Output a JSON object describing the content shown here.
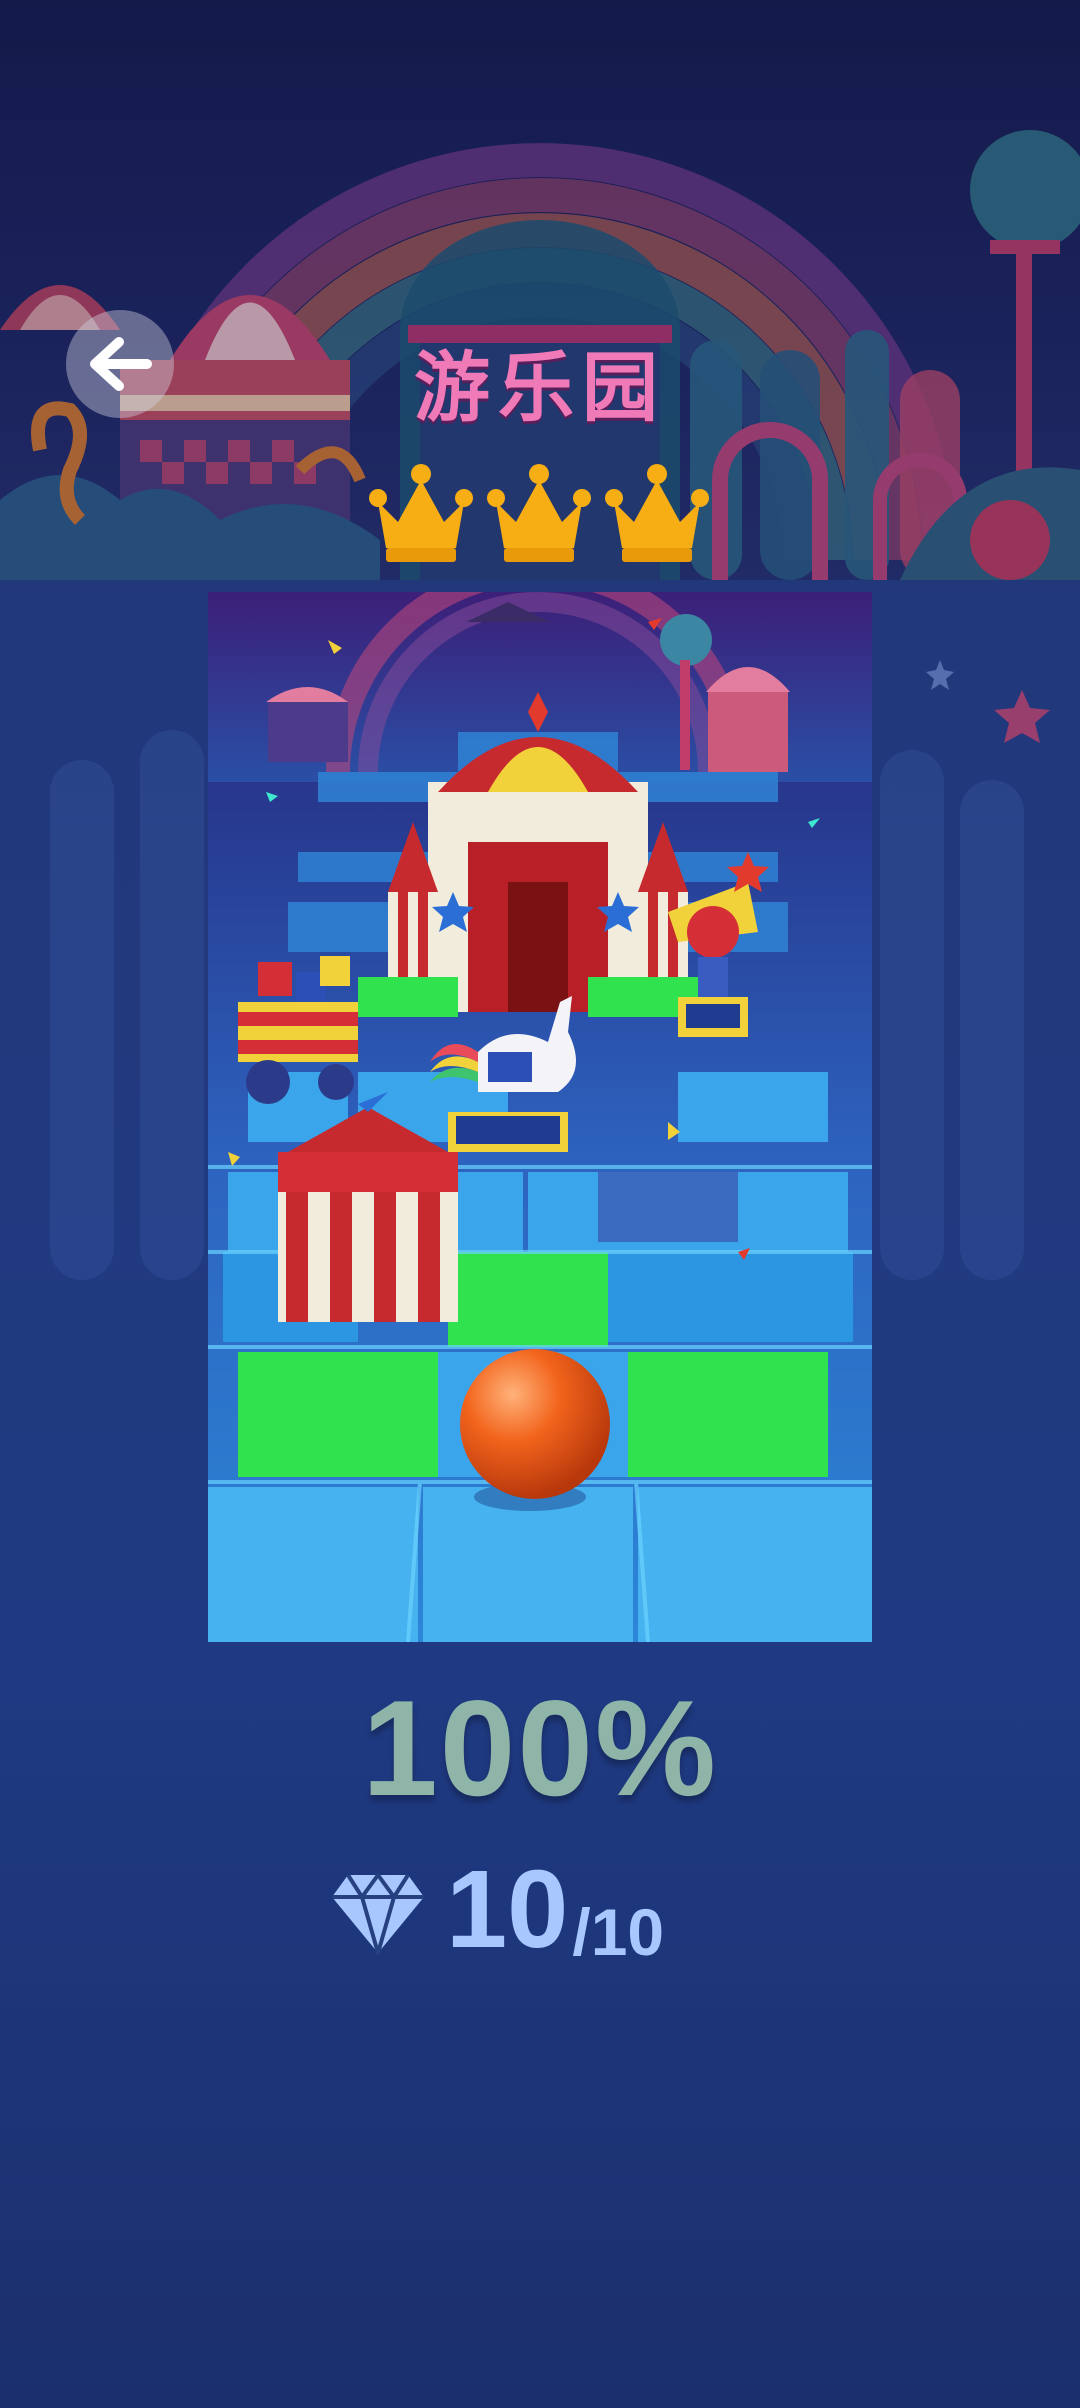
{
  "level": {
    "title": "游乐园",
    "crowns_earned": 3,
    "crowns_total": 3
  },
  "result": {
    "percent_label": "100%",
    "gems_collected": "10",
    "gems_total": "/10"
  },
  "icons": {
    "back": "arrow-left-icon",
    "crown": "crown-icon",
    "gem": "diamond-icon",
    "ball": "orange-ball"
  },
  "colors": {
    "title": "#f07ab8",
    "crown": "#f6ae14",
    "percent": "#8fb5a8",
    "gems": "#a8c7ff",
    "tile_green": "#31e24f",
    "tile_blue": "#3aa5ea",
    "ball": "#f2641c"
  }
}
